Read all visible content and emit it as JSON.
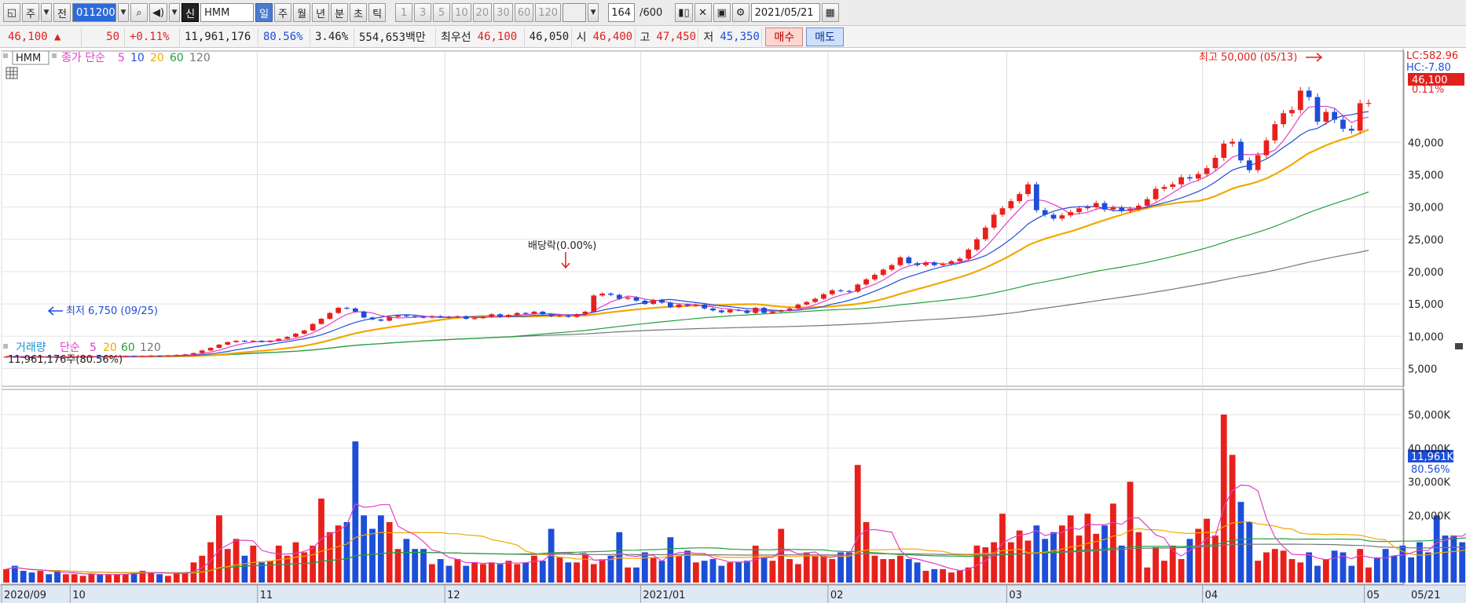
{
  "toolbar": {
    "period_type": "주",
    "full_label": "전",
    "code": "011200",
    "new_badge": "신",
    "name": "HMM",
    "periods": [
      "일",
      "주",
      "월",
      "년",
      "분",
      "초",
      "틱"
    ],
    "active_period": "일",
    "intervals": [
      "1",
      "3",
      "5",
      "10",
      "20",
      "30",
      "60",
      "120"
    ],
    "count_value": "164",
    "count_max": "/600",
    "date": "2021/05/21"
  },
  "quote": {
    "price": "46,100 ▲",
    "change": "50",
    "change_pct": "+0.11%",
    "volume": "11,961,176",
    "volume_ratio": "80.56%",
    "turnover": "3.46%",
    "amount": "554,653백만",
    "best_ask_label": "최우선",
    "best_ask": "46,100",
    "best_bid": "46,050",
    "open_label": "시",
    "open": "46,400",
    "high_label": "고",
    "high": "47,450",
    "low_label": "저",
    "low": "45,350",
    "buy_label": "매수",
    "sell_label": "매도"
  },
  "price_panel": {
    "legend_name": "HMM",
    "legend_title": "종가 단순",
    "ma_labels": [
      "5",
      "10",
      "20",
      "60",
      "120"
    ],
    "ma_colors": [
      "#e040c8",
      "#1d4ed8",
      "#f2a800",
      "#23a03c",
      "#777777"
    ],
    "lc_label": "LC:582.96",
    "hc_label": "HC:-7.80",
    "current_price": "46,100",
    "current_pct": "0.11%",
    "high_annotation": "최고 50,000 (05/13)",
    "low_annotation": "최저 6,750 (09/25)",
    "dividend_annotation": "배당락(0.00%)",
    "y_ticks": [
      "40,000",
      "35,000",
      "30,000",
      "25,000",
      "20,000",
      "15,000",
      "10,000",
      "5,000"
    ]
  },
  "volume_panel": {
    "legend_title": "거래량",
    "legend_simple": "단순",
    "ma_labels": [
      "5",
      "20",
      "60",
      "120"
    ],
    "ma_colors": [
      "#e040c8",
      "#f2a800",
      "#23a03c",
      "#777777"
    ],
    "volume_text": "11,961,176주(80.56%)",
    "current_volume": "11,961K",
    "current_pct": "80.56%",
    "y_ticks": [
      "50,000K",
      "40,000K",
      "30,000K",
      "20,000K"
    ]
  },
  "x_axis": {
    "labels": [
      "2020/09",
      "10",
      "11",
      "12",
      "2021/01",
      "02",
      "03",
      "04",
      "05"
    ],
    "end_label": "05/21"
  },
  "chart_data": {
    "type": "candlestick",
    "symbol": "HMM",
    "period": "daily",
    "x_range": [
      "2020/09",
      "2021/05/21"
    ],
    "price_ylim": [
      2500,
      54000
    ],
    "close": [
      6850,
      6800,
      6780,
      6750,
      6850,
      6800,
      6780,
      6800,
      6820,
      6850,
      6900,
      6880,
      6900,
      6920,
      6950,
      6900,
      6950,
      7000,
      6980,
      7050,
      7100,
      7200,
      7400,
      7800,
      8200,
      8700,
      9100,
      9300,
      9200,
      9300,
      9100,
      9300,
      9600,
      9900,
      10400,
      10900,
      11900,
      12700,
      13600,
      14400,
      14300,
      13800,
      12900,
      12600,
      12400,
      13000,
      13200,
      13100,
      13000,
      12900,
      13100,
      13000,
      12900,
      13100,
      12700,
      12800,
      13000,
      13400,
      13000,
      13300,
      13600,
      13500,
      13800,
      13400,
      13100,
      13200,
      13000,
      13400,
      13800,
      16300,
      16600,
      16400,
      15800,
      16000,
      15500,
      15000,
      15600,
      15200,
      14500,
      14900,
      14700,
      14900,
      14300,
      14000,
      13700,
      14100,
      14000,
      13600,
      14400,
      13600,
      13800,
      14000,
      14300,
      14900,
      15300,
      15800,
      16500,
      17100,
      17000,
      16900,
      18000,
      18800,
      19500,
      20300,
      21000,
      22200,
      21300,
      21000,
      21400,
      21000,
      21200,
      21600,
      22000,
      23400,
      25000,
      26800,
      28800,
      29800,
      30900,
      32000,
      33500,
      29500,
      28800,
      28200,
      28700,
      29200,
      29800,
      30000,
      30600,
      29600,
      29900,
      29400,
      29700,
      30200,
      31200,
      32800,
      33100,
      33500,
      34600,
      34400,
      35100,
      36000,
      37600,
      39800,
      40100,
      37200,
      35700,
      38000,
      40300,
      42800,
      44500,
      45000,
      48000,
      47000,
      43200,
      44700,
      43500,
      42100,
      41800,
      46050,
      46100
    ],
    "volume_k": [
      4000,
      5000,
      3500,
      3000,
      3500,
      2500,
      3500,
      2500,
      2500,
      2000,
      2500,
      2500,
      2500,
      2500,
      2500,
      3000,
      3500,
      3000,
      2500,
      2000,
      3000,
      3000,
      6000,
      8000,
      12000,
      20000,
      10000,
      13000,
      8000,
      11000,
      6000,
      6500,
      11000,
      8000,
      12000,
      9000,
      11000,
      25000,
      15000,
      17000,
      18000,
      42000,
      20000,
      16000,
      20000,
      18000,
      10000,
      13000,
      10000,
      10000,
      5500,
      7000,
      5000,
      7000,
      5000,
      6000,
      5500,
      6000,
      5500,
      6500,
      5500,
      6000,
      8000,
      6500,
      16000,
      7500,
      6000,
      6000,
      8500,
      5500,
      7000,
      8000,
      15000,
      4500,
      4500,
      9000,
      7500,
      6500,
      13500,
      8000,
      9500,
      6000,
      6500,
      7000,
      5000,
      6000,
      6000,
      6500,
      11000,
      7500,
      6500,
      16000,
      7000,
      5500,
      9000,
      8000,
      8000,
      7000,
      9000,
      9000,
      35000,
      18000,
      8000,
      7000,
      7000,
      8000,
      7000,
      6000,
      3500,
      4000,
      4000,
      3000,
      3500,
      4500,
      11000,
      10500,
      12000,
      20500,
      12000,
      15500,
      12500,
      17000,
      13000,
      15000,
      17000,
      20000,
      14000,
      20500,
      14500,
      17000,
      23500,
      11000,
      30000,
      15000,
      4500,
      10500,
      6500,
      11000,
      7000,
      13000,
      16000,
      19000,
      14000,
      50000,
      38000,
      24000,
      18000,
      6500,
      9000,
      10000,
      9500,
      7000,
      6000,
      9000,
      5000,
      7000,
      9500,
      9000,
      5000,
      10000,
      4500,
      7500,
      10000,
      8000,
      11000,
      7500,
      12000,
      9000,
      20000,
      14000,
      14000,
      12000,
      17000,
      11000,
      26000,
      15000,
      18000,
      11500,
      20000,
      12500,
      17500,
      16000,
      25500,
      17000,
      18500,
      10000,
      14000,
      11961
    ]
  }
}
